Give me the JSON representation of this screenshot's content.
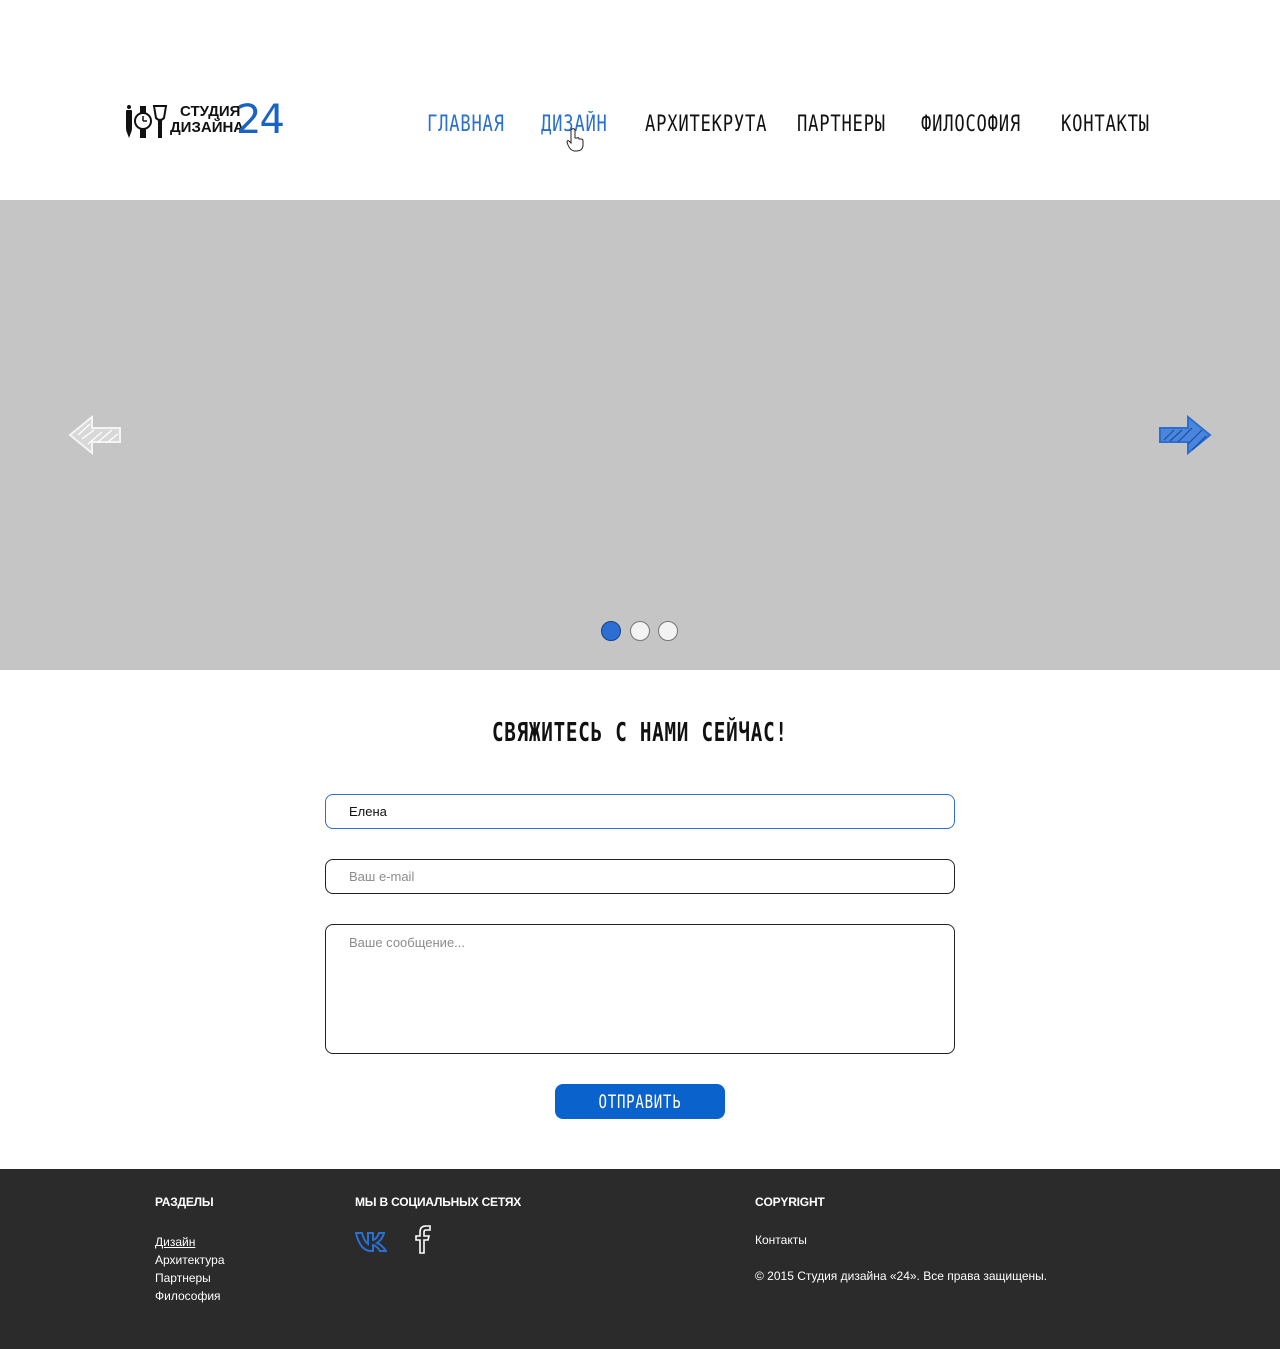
{
  "header": {
    "logo": {
      "line1": "СТУДИЯ",
      "line2": "ДИЗАЙНА",
      "number": "24"
    },
    "nav": [
      {
        "label": "Главная"
      },
      {
        "label": "Дизайн"
      },
      {
        "label": "Архитекрута"
      },
      {
        "label": "Партнеры"
      },
      {
        "label": "Философия"
      },
      {
        "label": "Контакты"
      }
    ]
  },
  "slider": {
    "slide_count": 3,
    "active_index": 0,
    "colors": {
      "active_dot": "#2a6fd1",
      "arrow_right": "#2a6fd1",
      "arrow_left": "#e6e6e6"
    }
  },
  "contact": {
    "title": "Свяжитесь с нами сейчас!",
    "name_value": "Елена",
    "email_placeholder": "Ваш e-mail",
    "message_placeholder": "Ваше сообщение...",
    "submit_label": "Отправить"
  },
  "footer": {
    "sections_heading": "Разделы",
    "sections": [
      {
        "label": "Дизайн"
      },
      {
        "label": "Архитектура"
      },
      {
        "label": "Партнеры"
      },
      {
        "label": "Философия"
      }
    ],
    "social_heading": "Мы в социальных сетях",
    "social_icons": [
      "vk-icon",
      "facebook-icon"
    ],
    "copyright_heading": "Copyright",
    "contacts_link": "Контакты",
    "copyright_text": "© 2015 Студия дизайна «24». Все права защищены."
  },
  "colors": {
    "accent": "#0a62cc",
    "footer_bg": "#2b2b2b",
    "slider_bg": "#c5c5c5"
  }
}
